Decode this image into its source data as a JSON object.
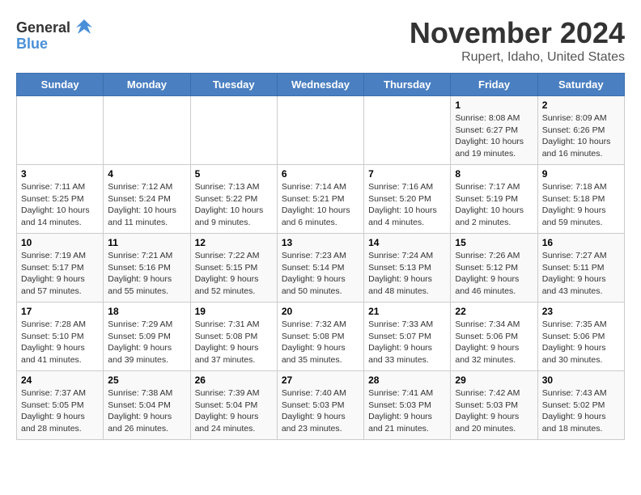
{
  "header": {
    "logo_general": "General",
    "logo_blue": "Blue",
    "month_title": "November 2024",
    "location": "Rupert, Idaho, United States"
  },
  "weekdays": [
    "Sunday",
    "Monday",
    "Tuesday",
    "Wednesday",
    "Thursday",
    "Friday",
    "Saturday"
  ],
  "weeks": [
    [
      {
        "day": "",
        "info": ""
      },
      {
        "day": "",
        "info": ""
      },
      {
        "day": "",
        "info": ""
      },
      {
        "day": "",
        "info": ""
      },
      {
        "day": "",
        "info": ""
      },
      {
        "day": "1",
        "info": "Sunrise: 8:08 AM\nSunset: 6:27 PM\nDaylight: 10 hours and 19 minutes."
      },
      {
        "day": "2",
        "info": "Sunrise: 8:09 AM\nSunset: 6:26 PM\nDaylight: 10 hours and 16 minutes."
      }
    ],
    [
      {
        "day": "3",
        "info": "Sunrise: 7:11 AM\nSunset: 5:25 PM\nDaylight: 10 hours and 14 minutes."
      },
      {
        "day": "4",
        "info": "Sunrise: 7:12 AM\nSunset: 5:24 PM\nDaylight: 10 hours and 11 minutes."
      },
      {
        "day": "5",
        "info": "Sunrise: 7:13 AM\nSunset: 5:22 PM\nDaylight: 10 hours and 9 minutes."
      },
      {
        "day": "6",
        "info": "Sunrise: 7:14 AM\nSunset: 5:21 PM\nDaylight: 10 hours and 6 minutes."
      },
      {
        "day": "7",
        "info": "Sunrise: 7:16 AM\nSunset: 5:20 PM\nDaylight: 10 hours and 4 minutes."
      },
      {
        "day": "8",
        "info": "Sunrise: 7:17 AM\nSunset: 5:19 PM\nDaylight: 10 hours and 2 minutes."
      },
      {
        "day": "9",
        "info": "Sunrise: 7:18 AM\nSunset: 5:18 PM\nDaylight: 9 hours and 59 minutes."
      }
    ],
    [
      {
        "day": "10",
        "info": "Sunrise: 7:19 AM\nSunset: 5:17 PM\nDaylight: 9 hours and 57 minutes."
      },
      {
        "day": "11",
        "info": "Sunrise: 7:21 AM\nSunset: 5:16 PM\nDaylight: 9 hours and 55 minutes."
      },
      {
        "day": "12",
        "info": "Sunrise: 7:22 AM\nSunset: 5:15 PM\nDaylight: 9 hours and 52 minutes."
      },
      {
        "day": "13",
        "info": "Sunrise: 7:23 AM\nSunset: 5:14 PM\nDaylight: 9 hours and 50 minutes."
      },
      {
        "day": "14",
        "info": "Sunrise: 7:24 AM\nSunset: 5:13 PM\nDaylight: 9 hours and 48 minutes."
      },
      {
        "day": "15",
        "info": "Sunrise: 7:26 AM\nSunset: 5:12 PM\nDaylight: 9 hours and 46 minutes."
      },
      {
        "day": "16",
        "info": "Sunrise: 7:27 AM\nSunset: 5:11 PM\nDaylight: 9 hours and 43 minutes."
      }
    ],
    [
      {
        "day": "17",
        "info": "Sunrise: 7:28 AM\nSunset: 5:10 PM\nDaylight: 9 hours and 41 minutes."
      },
      {
        "day": "18",
        "info": "Sunrise: 7:29 AM\nSunset: 5:09 PM\nDaylight: 9 hours and 39 minutes."
      },
      {
        "day": "19",
        "info": "Sunrise: 7:31 AM\nSunset: 5:08 PM\nDaylight: 9 hours and 37 minutes."
      },
      {
        "day": "20",
        "info": "Sunrise: 7:32 AM\nSunset: 5:08 PM\nDaylight: 9 hours and 35 minutes."
      },
      {
        "day": "21",
        "info": "Sunrise: 7:33 AM\nSunset: 5:07 PM\nDaylight: 9 hours and 33 minutes."
      },
      {
        "day": "22",
        "info": "Sunrise: 7:34 AM\nSunset: 5:06 PM\nDaylight: 9 hours and 32 minutes."
      },
      {
        "day": "23",
        "info": "Sunrise: 7:35 AM\nSunset: 5:06 PM\nDaylight: 9 hours and 30 minutes."
      }
    ],
    [
      {
        "day": "24",
        "info": "Sunrise: 7:37 AM\nSunset: 5:05 PM\nDaylight: 9 hours and 28 minutes."
      },
      {
        "day": "25",
        "info": "Sunrise: 7:38 AM\nSunset: 5:04 PM\nDaylight: 9 hours and 26 minutes."
      },
      {
        "day": "26",
        "info": "Sunrise: 7:39 AM\nSunset: 5:04 PM\nDaylight: 9 hours and 24 minutes."
      },
      {
        "day": "27",
        "info": "Sunrise: 7:40 AM\nSunset: 5:03 PM\nDaylight: 9 hours and 23 minutes."
      },
      {
        "day": "28",
        "info": "Sunrise: 7:41 AM\nSunset: 5:03 PM\nDaylight: 9 hours and 21 minutes."
      },
      {
        "day": "29",
        "info": "Sunrise: 7:42 AM\nSunset: 5:03 PM\nDaylight: 9 hours and 20 minutes."
      },
      {
        "day": "30",
        "info": "Sunrise: 7:43 AM\nSunset: 5:02 PM\nDaylight: 9 hours and 18 minutes."
      }
    ]
  ]
}
